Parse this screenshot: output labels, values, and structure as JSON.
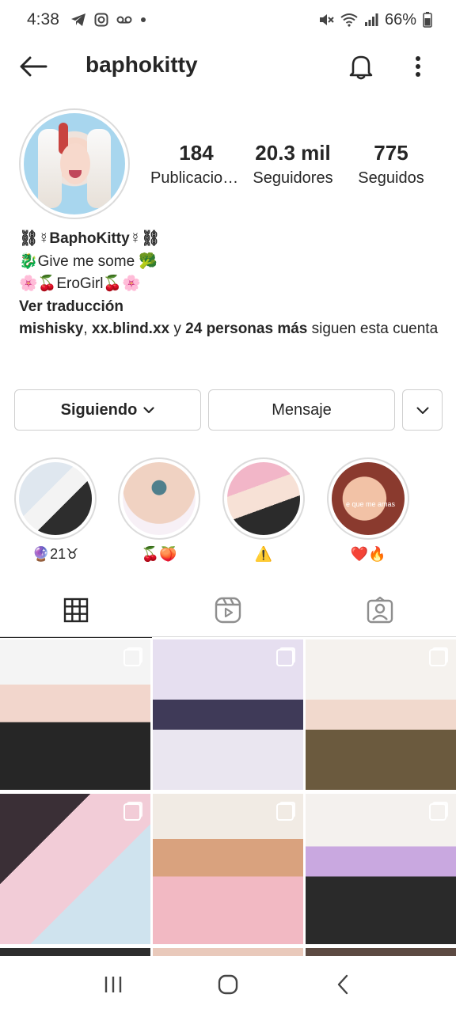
{
  "status_bar": {
    "time": "4:38",
    "battery": "66%",
    "icons": [
      "telegram-icon",
      "instagram-icon",
      "voicemail-icon",
      "dot-icon",
      "mute-icon",
      "wifi-icon",
      "signal-icon",
      "battery-icon"
    ]
  },
  "header": {
    "username": "baphokitty",
    "icons": [
      "back-arrow-icon",
      "bell-icon",
      "more-vertical-icon"
    ]
  },
  "stats": {
    "posts": {
      "value": "184",
      "label": "Publicaciones"
    },
    "followers": {
      "value": "20.3 mil",
      "label": "Seguidores"
    },
    "following": {
      "value": "775",
      "label": "Seguidos"
    }
  },
  "bio": {
    "name_line": "⛓☿BaphoKitty☿⛓",
    "line2": "🐉Give me some 🥦",
    "line3": "🌸🍒EroGirl🍒🌸",
    "translate": "Ver traducción",
    "followed_by": {
      "user1": "mishisky",
      "sep": ", ",
      "user2": "xx.blind.xx",
      "and": " y ",
      "others": "24 personas más",
      "suffix": " siguen esta cuenta"
    }
  },
  "actions": {
    "following_label": "Siguiendo",
    "message_label": "Mensaje"
  },
  "highlights": [
    {
      "label": "🔮21♉",
      "overlay": ""
    },
    {
      "label": "🍒🍑",
      "overlay": ""
    },
    {
      "label": "⚠️",
      "overlay": ""
    },
    {
      "label": "❤️🔥",
      "overlay": "e que me amas"
    }
  ],
  "tabs": [
    {
      "name": "grid",
      "icon": "grid-icon",
      "active": true
    },
    {
      "name": "reels",
      "icon": "reels-icon",
      "active": false
    },
    {
      "name": "tagged",
      "icon": "tagged-icon",
      "active": false
    }
  ],
  "colors": {
    "text": "#262626",
    "border": "#dbdbdb",
    "background": "#ffffff"
  }
}
